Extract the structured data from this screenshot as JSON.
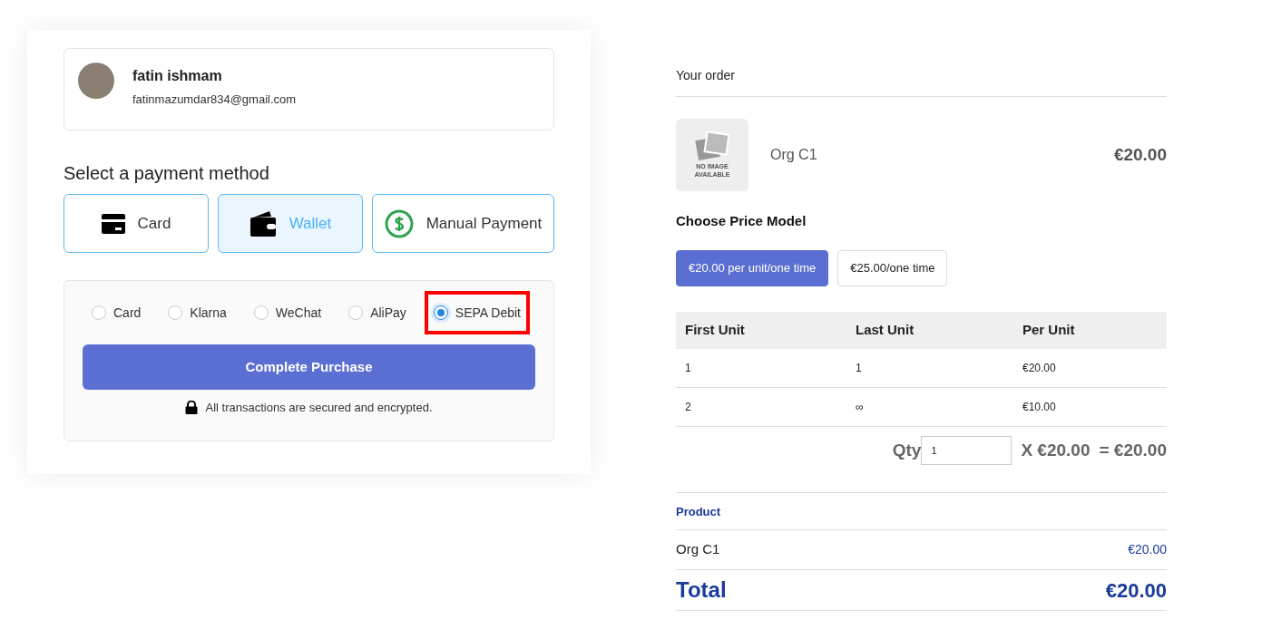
{
  "user": {
    "name": "fatin ishmam",
    "email": "fatinmazumdar834@gmail.com"
  },
  "payment": {
    "heading": "Select a payment method",
    "methods": [
      {
        "kind": "card",
        "label": "Card",
        "selected": false
      },
      {
        "kind": "wallet",
        "label": "Wallet",
        "selected": true
      },
      {
        "kind": "manual",
        "label": "Manual Payment",
        "selected": false
      }
    ],
    "options": [
      {
        "label": "Card",
        "selected": false,
        "highlighted": false
      },
      {
        "label": "Klarna",
        "selected": false,
        "highlighted": false
      },
      {
        "label": "WeChat",
        "selected": false,
        "highlighted": false
      },
      {
        "label": "AliPay",
        "selected": false,
        "highlighted": false
      },
      {
        "label": "SEPA Debit",
        "selected": true,
        "highlighted": true
      }
    ],
    "button": "Complete Purchase",
    "secure_note": "All transactions are secured and encrypted."
  },
  "order": {
    "title": "Your order",
    "item": {
      "image_text": [
        "NO IMAGE",
        "AVAILABLE"
      ],
      "name": "Org C1",
      "price": "€20.00"
    },
    "price_model_heading": "Choose Price Model",
    "price_models": [
      {
        "label": "€20.00 per unit/one time",
        "selected": true
      },
      {
        "label": "€25.00/one time",
        "selected": false
      }
    ],
    "tiers": {
      "columns": [
        "First Unit",
        "Last Unit",
        "Per Unit"
      ],
      "rows": [
        [
          "1",
          "1",
          "€20.00"
        ],
        [
          "2",
          "∞",
          "€10.00"
        ]
      ]
    },
    "qty": {
      "label": "Qty",
      "value": "1",
      "unit_price": "X €20.00",
      "result": "= €20.00"
    },
    "summary": {
      "header": "Product",
      "line_name": "Org C1",
      "line_price": "€20.00",
      "total_label": "Total",
      "total": "€20.00"
    }
  }
}
